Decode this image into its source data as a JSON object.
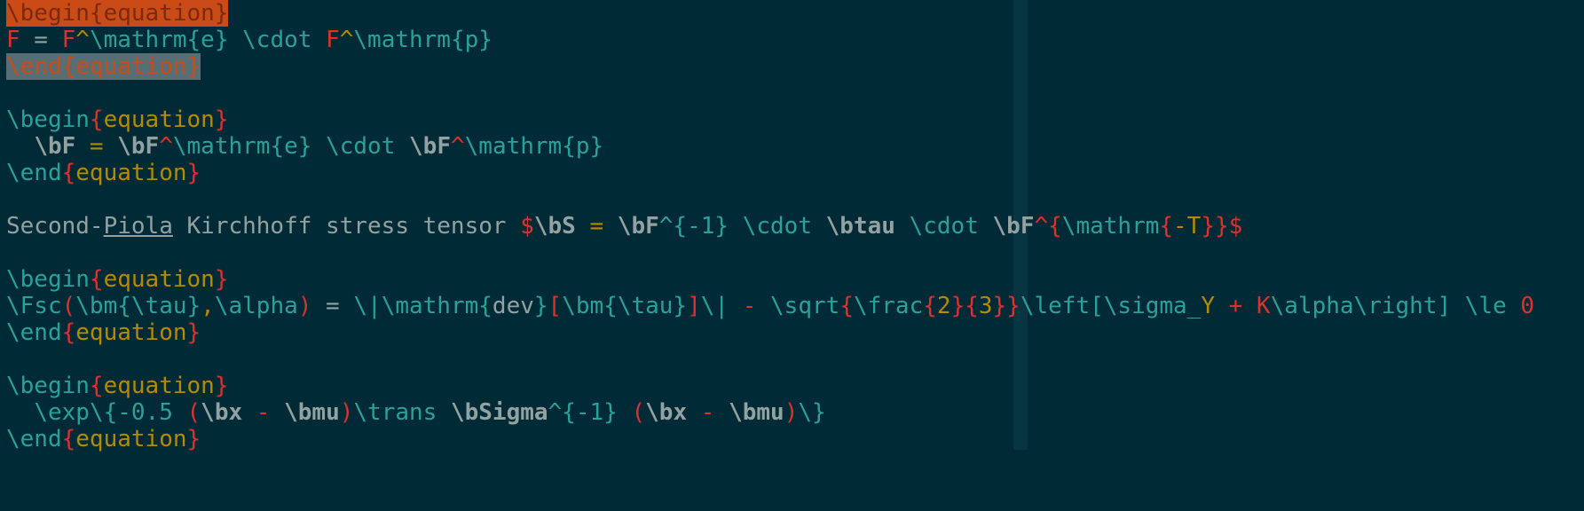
{
  "editor": {
    "colors": {
      "background": "#002b36",
      "color_column": "#073642",
      "text": "#93a1a1",
      "command": "#2aa198",
      "delimiter": "#dc322f",
      "argument": "#b58900",
      "selection": "#586e75",
      "cursor": "#cb4b16"
    },
    "lines": [
      [
        {
          "t": "\\begin{equation}",
          "c": "cursorsel"
        }
      ],
      [
        {
          "t": "F",
          "c": "red"
        },
        {
          "t": " = ",
          "c": "text"
        },
        {
          "t": "F",
          "c": "red"
        },
        {
          "t": "^",
          "c": "yellow"
        },
        {
          "t": "\\mathrm",
          "c": "cmd"
        },
        {
          "t": "{e}",
          "c": "cmd"
        },
        {
          "t": " ",
          "c": "text"
        },
        {
          "t": "\\cdot",
          "c": "cmd"
        },
        {
          "t": " ",
          "c": "text"
        },
        {
          "t": "F",
          "c": "red"
        },
        {
          "t": "^",
          "c": "yellow"
        },
        {
          "t": "\\mathrm",
          "c": "cmd"
        },
        {
          "t": "{p}",
          "c": "cmd"
        }
      ],
      [
        {
          "t": "\\end{equation}",
          "c": "sel"
        }
      ],
      [],
      [
        {
          "t": "\\begin",
          "c": "cmd"
        },
        {
          "t": "{",
          "c": "red"
        },
        {
          "t": "equation",
          "c": "yellow"
        },
        {
          "t": "}",
          "c": "red"
        }
      ],
      [
        {
          "t": "  ",
          "c": "text"
        },
        {
          "t": "\\bF",
          "c": "bold"
        },
        {
          "t": " = ",
          "c": "yellow"
        },
        {
          "t": "\\bF",
          "c": "bold"
        },
        {
          "t": "^",
          "c": "red"
        },
        {
          "t": "\\mathrm",
          "c": "cmd"
        },
        {
          "t": "{e}",
          "c": "cmd"
        },
        {
          "t": " ",
          "c": "text"
        },
        {
          "t": "\\cdot",
          "c": "cmd"
        },
        {
          "t": " ",
          "c": "text"
        },
        {
          "t": "\\bF",
          "c": "bold"
        },
        {
          "t": "^",
          "c": "red"
        },
        {
          "t": "\\mathrm",
          "c": "cmd"
        },
        {
          "t": "{p}",
          "c": "cmd"
        }
      ],
      [
        {
          "t": "\\end",
          "c": "cmd"
        },
        {
          "t": "{",
          "c": "red"
        },
        {
          "t": "equation",
          "c": "yellow"
        },
        {
          "t": "}",
          "c": "red"
        }
      ],
      [],
      [
        {
          "t": "Second-",
          "c": "text"
        },
        {
          "t": "Piola",
          "c": "under"
        },
        {
          "t": " Kirchhoff stress tensor ",
          "c": "text"
        },
        {
          "t": "$",
          "c": "red"
        },
        {
          "t": "\\bS",
          "c": "bold"
        },
        {
          "t": " = ",
          "c": "yellow"
        },
        {
          "t": "\\bF",
          "c": "bold"
        },
        {
          "t": "^{-1}",
          "c": "cmd"
        },
        {
          "t": " ",
          "c": "text"
        },
        {
          "t": "\\cdot",
          "c": "cmd"
        },
        {
          "t": " ",
          "c": "text"
        },
        {
          "t": "\\btau",
          "c": "bold"
        },
        {
          "t": " ",
          "c": "text"
        },
        {
          "t": "\\cdot",
          "c": "cmd"
        },
        {
          "t": " ",
          "c": "text"
        },
        {
          "t": "\\bF",
          "c": "bold"
        },
        {
          "t": "^",
          "c": "red"
        },
        {
          "t": "{",
          "c": "red"
        },
        {
          "t": "\\mathrm",
          "c": "cmd"
        },
        {
          "t": "{",
          "c": "red"
        },
        {
          "t": "-T",
          "c": "yellow"
        },
        {
          "t": "}}",
          "c": "red"
        },
        {
          "t": "$",
          "c": "red"
        }
      ],
      [],
      [
        {
          "t": "\\begin",
          "c": "cmd"
        },
        {
          "t": "{",
          "c": "red"
        },
        {
          "t": "equation",
          "c": "yellow"
        },
        {
          "t": "}",
          "c": "red"
        }
      ],
      [
        {
          "t": "\\Fsc",
          "c": "cmd"
        },
        {
          "t": "(",
          "c": "red"
        },
        {
          "t": "\\bm{\\tau}",
          "c": "cmd"
        },
        {
          "t": ",",
          "c": "yellow"
        },
        {
          "t": "\\alpha",
          "c": "cmd"
        },
        {
          "t": ")",
          "c": "red"
        },
        {
          "t": " = ",
          "c": "text"
        },
        {
          "t": "\\|",
          "c": "cmd"
        },
        {
          "t": "\\mathrm",
          "c": "cmd"
        },
        {
          "t": "{",
          "c": "cmd"
        },
        {
          "t": "dev",
          "c": "text"
        },
        {
          "t": "}",
          "c": "cmd"
        },
        {
          "t": "[",
          "c": "red"
        },
        {
          "t": "\\bm{\\tau}",
          "c": "cmd"
        },
        {
          "t": "]",
          "c": "red"
        },
        {
          "t": "\\|",
          "c": "cmd"
        },
        {
          "t": " - ",
          "c": "red"
        },
        {
          "t": "\\sqrt",
          "c": "cmd"
        },
        {
          "t": "{",
          "c": "red"
        },
        {
          "t": "\\frac",
          "c": "cmd"
        },
        {
          "t": "{",
          "c": "red"
        },
        {
          "t": "2",
          "c": "yellow"
        },
        {
          "t": "}{",
          "c": "red"
        },
        {
          "t": "3",
          "c": "yellow"
        },
        {
          "t": "}}",
          "c": "red"
        },
        {
          "t": "\\left[",
          "c": "cmd"
        },
        {
          "t": "\\sigma_",
          "c": "cmd"
        },
        {
          "t": "Y",
          "c": "yellow"
        },
        {
          "t": " + ",
          "c": "red"
        },
        {
          "t": "K",
          "c": "red"
        },
        {
          "t": "\\alpha",
          "c": "cmd"
        },
        {
          "t": "\\right]",
          "c": "cmd"
        },
        {
          "t": " ",
          "c": "text"
        },
        {
          "t": "\\le",
          "c": "cmd"
        },
        {
          "t": " 0",
          "c": "red"
        }
      ],
      [
        {
          "t": "\\end",
          "c": "cmd"
        },
        {
          "t": "{",
          "c": "red"
        },
        {
          "t": "equation",
          "c": "yellow"
        },
        {
          "t": "}",
          "c": "red"
        }
      ],
      [],
      [
        {
          "t": "\\begin",
          "c": "cmd"
        },
        {
          "t": "{",
          "c": "red"
        },
        {
          "t": "equation",
          "c": "yellow"
        },
        {
          "t": "}",
          "c": "red"
        }
      ],
      [
        {
          "t": "  ",
          "c": "text"
        },
        {
          "t": "\\exp",
          "c": "cmd"
        },
        {
          "t": "\\{-0.5 ",
          "c": "cmd"
        },
        {
          "t": "(",
          "c": "red"
        },
        {
          "t": "\\bx",
          "c": "bold"
        },
        {
          "t": " - ",
          "c": "red"
        },
        {
          "t": "\\bmu",
          "c": "bold"
        },
        {
          "t": ")",
          "c": "red"
        },
        {
          "t": "\\trans",
          "c": "cmd"
        },
        {
          "t": " ",
          "c": "text"
        },
        {
          "t": "\\bSigma",
          "c": "bold"
        },
        {
          "t": "^{-1}",
          "c": "cmd"
        },
        {
          "t": " ",
          "c": "text"
        },
        {
          "t": "(",
          "c": "red"
        },
        {
          "t": "\\bx",
          "c": "bold"
        },
        {
          "t": " - ",
          "c": "red"
        },
        {
          "t": "\\bmu",
          "c": "bold"
        },
        {
          "t": ")",
          "c": "red"
        },
        {
          "t": "\\}",
          "c": "cmd"
        }
      ],
      [
        {
          "t": "\\end",
          "c": "cmd"
        },
        {
          "t": "{",
          "c": "red"
        },
        {
          "t": "equation",
          "c": "yellow"
        },
        {
          "t": "}",
          "c": "red"
        }
      ]
    ]
  }
}
